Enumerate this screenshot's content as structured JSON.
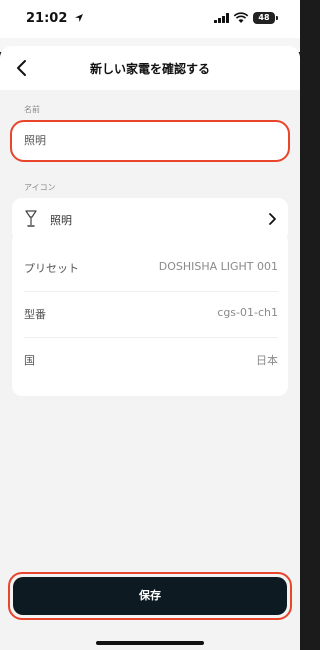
{
  "status_bar": {
    "time": "21:02",
    "battery": "48",
    "icons": [
      "location-arrow-icon",
      "cellular-signal-icon",
      "wifi-icon",
      "battery-icon"
    ]
  },
  "nav": {
    "title": "新しい家電を確認する",
    "back_icon": "chevron-left-icon"
  },
  "name_section": {
    "label": "名前",
    "value": "照明"
  },
  "icon_section": {
    "label": "アイコン",
    "icon": "lamp-icon",
    "value": "照明",
    "chevron": "chevron-right-icon"
  },
  "details": [
    {
      "key": "プリセット",
      "value": "DOSHISHA LIGHT 001"
    },
    {
      "key": "型番",
      "value": "cgs-01-ch1"
    },
    {
      "key": "国",
      "value": "日本"
    }
  ],
  "save_button": {
    "label": "保存"
  },
  "colors": {
    "accent_outline": "#e8452c",
    "button_bg": "#0e1a21",
    "page_bg": "#f3f3f3"
  }
}
